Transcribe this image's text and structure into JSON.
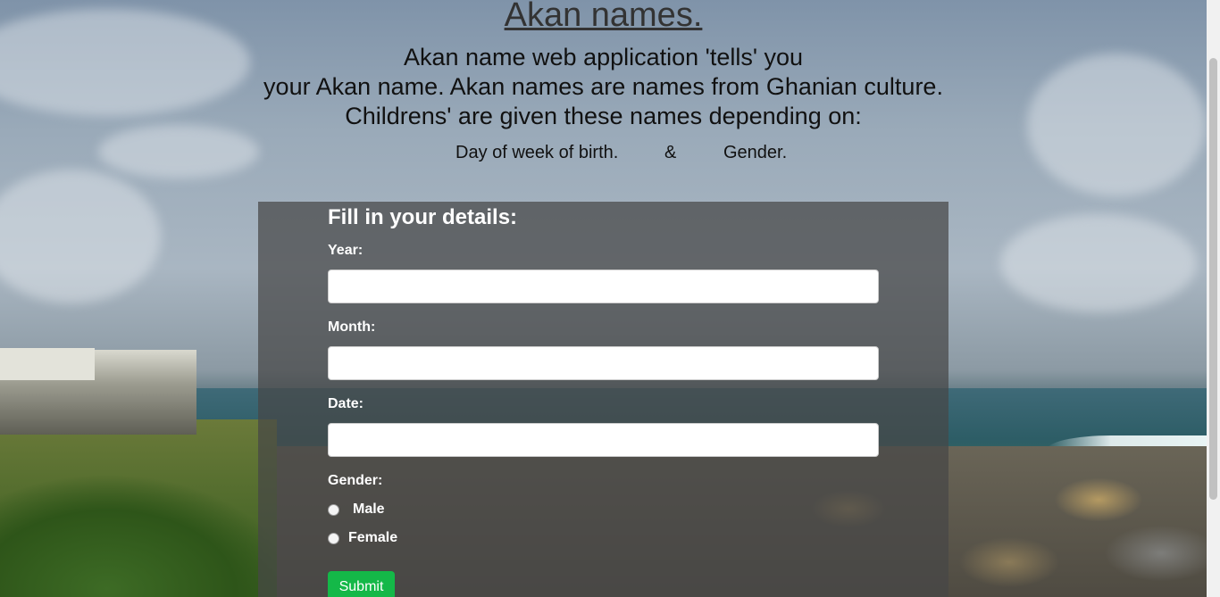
{
  "header": {
    "title": "Akan names.",
    "intro_lines": [
      "Akan name web application 'tells' you",
      "your Akan name. Akan names are names from Ghanian culture.",
      "Childrens' are given these names depending on:"
    ],
    "factors": {
      "day": "Day of week of birth.",
      "separator": "&",
      "gender": "Gender."
    }
  },
  "form": {
    "heading": "Fill in your details:",
    "year_label": "Year:",
    "year_value": "",
    "month_label": "Month:",
    "month_value": "",
    "date_label": "Date:",
    "date_value": "",
    "gender_label": "Gender:",
    "gender_options": [
      "Male",
      "Female"
    ],
    "submit_label": "Submit"
  },
  "colors": {
    "panel_overlay": "#464646",
    "submit_button": "#14b848",
    "text_dark": "#111111",
    "text_light": "#ffffff"
  }
}
